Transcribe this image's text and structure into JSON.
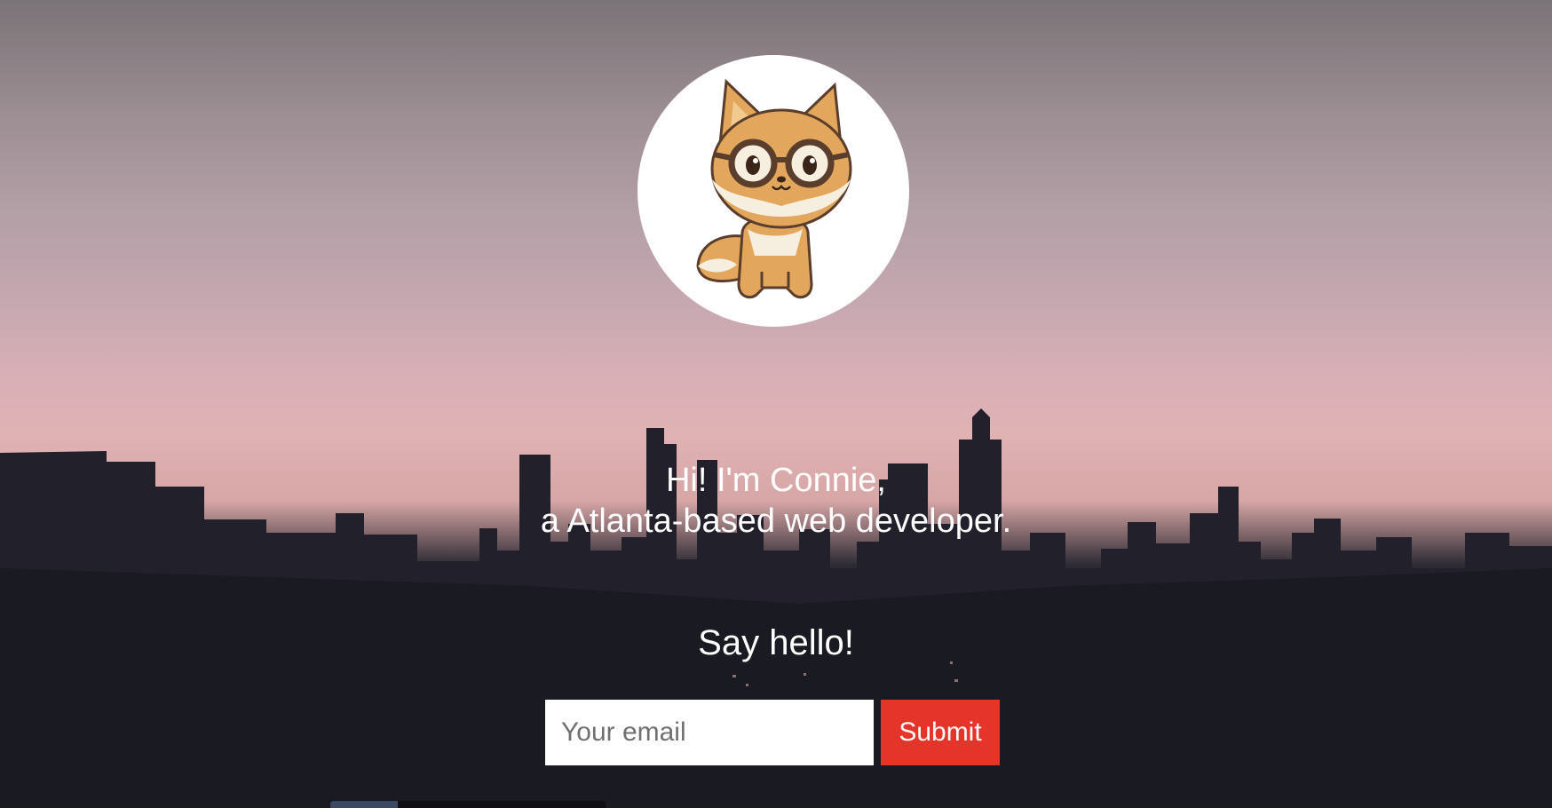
{
  "hero": {
    "avatar_icon": "fox-with-glasses-icon",
    "intro_line1": "Hi! I'm Connie,",
    "intro_line2": "a Atlanta-based web developer.",
    "say_hello": "Say hello!"
  },
  "form": {
    "email_placeholder": "Your email",
    "email_value": "",
    "submit_label": "Submit"
  },
  "colors": {
    "submit_background": "#e5342a",
    "text": "#ffffff"
  }
}
